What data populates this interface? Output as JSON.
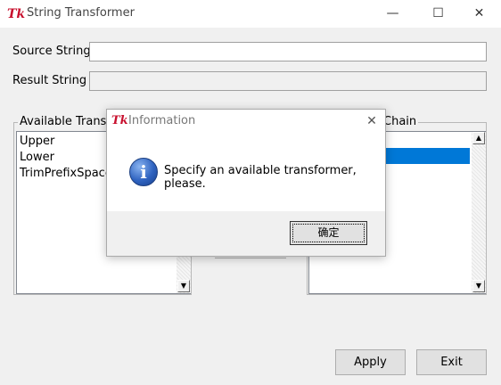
{
  "window": {
    "title": "String Transformer",
    "icon": "tk-feather-icon",
    "controls": {
      "minimize": "—",
      "maximize": "☐",
      "close": "✕"
    }
  },
  "form": {
    "source_label": "Source String",
    "source_value": "",
    "result_label": "Result String",
    "result_value": ""
  },
  "available": {
    "title": "Available Transfo",
    "items": [
      "Upper",
      "Lower",
      "TrimPrefixSpaces"
    ]
  },
  "chain": {
    "title": "Chain",
    "items": [
      ""
    ],
    "selected_index": 0
  },
  "buttons": {
    "apply": "Apply",
    "exit": "Exit"
  },
  "dialog": {
    "title": "Information",
    "message": "Specify an available transformer, please.",
    "icon": "info-icon",
    "ok_label": "确定",
    "close": "✕"
  },
  "colors": {
    "selection": "#0078d7",
    "tk_icon": "#c8102e"
  }
}
